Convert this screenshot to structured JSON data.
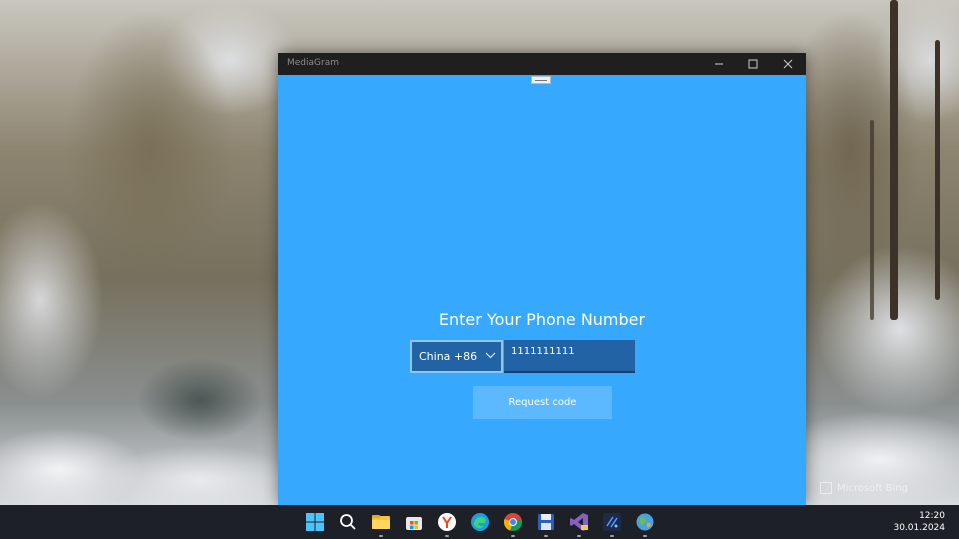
{
  "window": {
    "title": "MediaGram",
    "heading": "Enter Your Phone Number",
    "country_select": {
      "value": "China +86"
    },
    "phone_input": {
      "value": "1111111111"
    },
    "request_button": {
      "label": "Request code"
    }
  },
  "watermark": {
    "text": "Microsoft Bing"
  },
  "taskbar": {
    "apps": [
      "start-icon",
      "search-icon",
      "file-explorer-icon",
      "microsoft-store-icon",
      "yandex-browser-icon",
      "edge-icon",
      "chrome-icon",
      "save-disk-icon",
      "visual-studio-icon",
      "code-editor-icon",
      "globe-app-icon"
    ],
    "time": "12:20",
    "date": "30.01.2024"
  },
  "colors": {
    "app_background": "#36a9ff",
    "input_background": "#2163a5",
    "button_background": "#5db9ff",
    "titlebar": "#1f1f1f",
    "taskbar": "#1d2127"
  }
}
